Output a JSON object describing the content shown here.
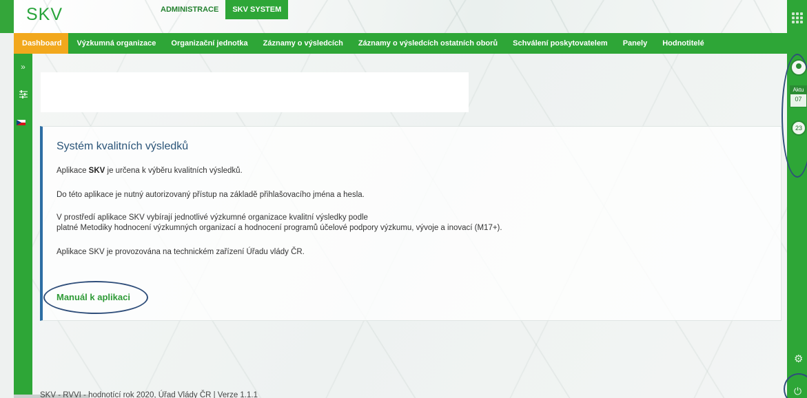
{
  "app": {
    "logo": "SKV",
    "tabs": [
      {
        "label": "ADMINISTRACE",
        "active": false
      },
      {
        "label": "SKV SYSTEM",
        "active": true
      }
    ]
  },
  "nav": {
    "items": [
      {
        "label": "Dashboard",
        "active": true
      },
      {
        "label": "Výzkumná organizace",
        "active": false
      },
      {
        "label": "Organizační jednotka",
        "active": false
      },
      {
        "label": "Záznamy o výsledcích",
        "active": false
      },
      {
        "label": "Záznamy o výsledcích ostatních oborů",
        "active": false
      },
      {
        "label": "Schválení poskytovatelem",
        "active": false
      },
      {
        "label": "Panely",
        "active": false
      },
      {
        "label": "Hodnotitelé",
        "active": false
      }
    ]
  },
  "sidebar_right": {
    "calendar_label": "Aktu",
    "calendar_value": "07",
    "clock_value": "23"
  },
  "main": {
    "title": "Systém kvalitních výsledků",
    "p1_prefix": "Aplikace ",
    "p1_bold": "SKV",
    "p1_suffix": " je určena k výběru kvalitních výsledků.",
    "p2": "Do této aplikace je nutný autorizovaný přístup na základě přihlašovacího jména a hesla.",
    "p3_line1": "V prostředí aplikace SKV vybírají jednotlivé výzkumné organizace kvalitní výsledky podle",
    "p3_line2": "platné Metodiky hodnocení výzkumných organizací a hodnocení programů účelové podpory výzkumu, vývoje a inovací (M17+).",
    "p4": "Aplikace SKV je provozována na technickém zařízení Úřadu vlády ČR.",
    "manual_link": "Manuál k aplikaci"
  },
  "footer": {
    "text": "SKV - RVVI - hodnotící rok 2020, Úřad Vlády ČR | Verze 1.1.1"
  },
  "colors": {
    "brand_green": "#2ea637",
    "active_orange": "#f2a81d",
    "title_blue": "#2a5478",
    "annotation_navy": "#2f4e7a"
  }
}
